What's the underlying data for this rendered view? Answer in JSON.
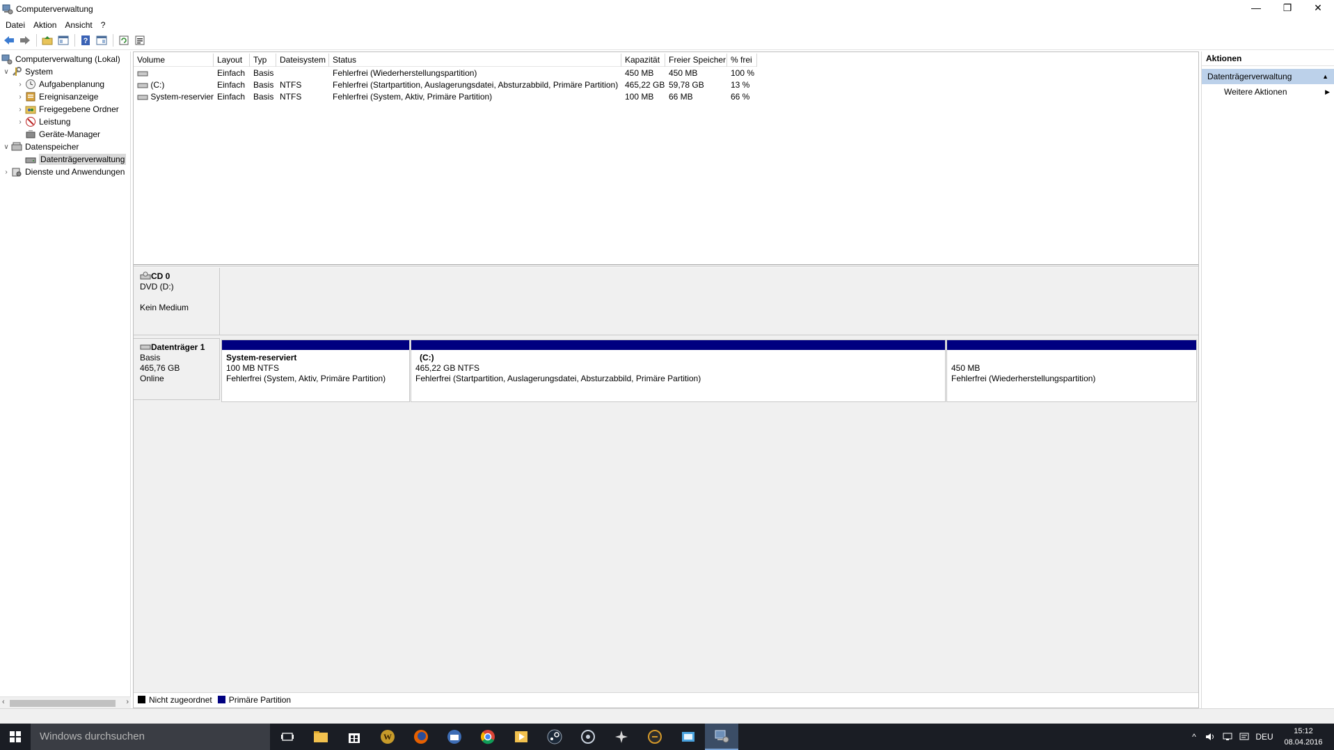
{
  "window": {
    "title": "Computerverwaltung"
  },
  "menu": [
    "Datei",
    "Aktion",
    "Ansicht",
    "?"
  ],
  "tree": {
    "root": "Computerverwaltung (Lokal)",
    "system": "System",
    "aufgabenplanung": "Aufgabenplanung",
    "ereignisanzeige": "Ereignisanzeige",
    "freigegebene_ordner": "Freigegebene Ordner",
    "leistung": "Leistung",
    "geraete_manager": "Geräte-Manager",
    "datenspeicher": "Datenspeicher",
    "datentraegerverwaltung": "Datenträgerverwaltung",
    "dienste": "Dienste und Anwendungen"
  },
  "volume_table": {
    "columns": [
      "Volume",
      "Layout",
      "Typ",
      "Dateisystem",
      "Status",
      "Kapazität",
      "Freier Speicher",
      "% frei"
    ],
    "rows": [
      [
        "",
        "Einfach",
        "Basis",
        "",
        "Fehlerfrei (Wiederherstellungspartition)",
        "450 MB",
        "450 MB",
        "100 %"
      ],
      [
        "(C:)",
        "Einfach",
        "Basis",
        "NTFS",
        "Fehlerfrei (Startpartition, Auslagerungsdatei, Absturzabbild, Primäre Partition)",
        "465,22 GB",
        "59,78 GB",
        "13 %"
      ],
      [
        "System-reserviert",
        "Einfach",
        "Basis",
        "NTFS",
        "Fehlerfrei (System, Aktiv, Primäre Partition)",
        "100 MB",
        "66 MB",
        "66 %"
      ]
    ]
  },
  "cd": {
    "name": "CD 0",
    "drive": "DVD (D:)",
    "media": "Kein Medium"
  },
  "disk1": {
    "name": "Datenträger 1",
    "type": "Basis",
    "size": "465,76 GB",
    "state": "Online",
    "partitions": [
      {
        "name": "System-reserviert",
        "size": "100 MB NTFS",
        "status": "Fehlerfrei (System, Aktiv, Primäre Partition)"
      },
      {
        "name": "(C:)",
        "size": "465,22 GB NTFS",
        "status": "Fehlerfrei (Startpartition, Auslagerungsdatei, Absturzabbild, Primäre Partition)"
      },
      {
        "name": "",
        "size": "450 MB",
        "status": "Fehlerfrei (Wiederherstellungspartition)"
      }
    ]
  },
  "legend": [
    {
      "label": "Nicht zugeordnet",
      "color": "#000000"
    },
    {
      "label": "Primäre Partition",
      "color": "#000080"
    }
  ],
  "actions": {
    "header": "Aktionen",
    "section": "Datenträgerverwaltung",
    "more": "Weitere Aktionen"
  },
  "taskbar": {
    "search_placeholder": "Windows durchsuchen",
    "language": "DEU",
    "time": "15:12",
    "date": "08.04.2016",
    "apps": [
      "task-view",
      "file-explorer",
      "store",
      "world-of-warcraft",
      "firefox",
      "thunderbird",
      "chrome",
      "media-player",
      "steam",
      "app-9",
      "app-10",
      "app-11",
      "app-12",
      "computer-management"
    ]
  },
  "colors": {
    "primary_partition": "#000080",
    "selection": "#bcd1ea",
    "taskbar": "#1a1d24"
  }
}
